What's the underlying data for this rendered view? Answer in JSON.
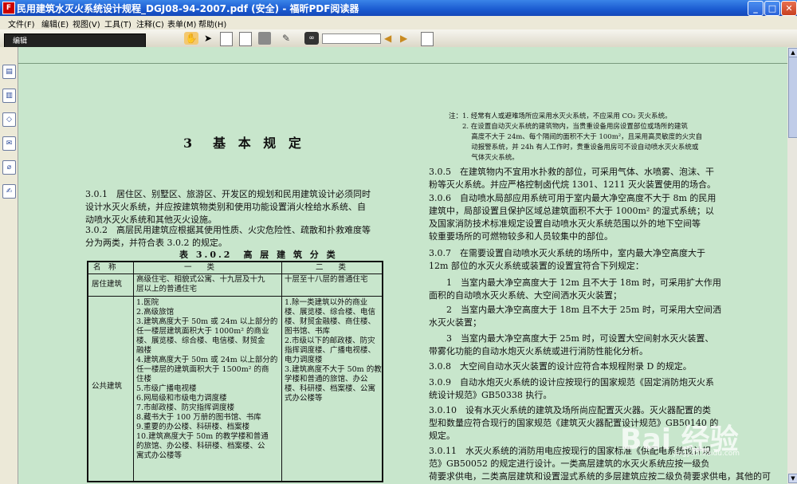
{
  "window": {
    "title": "民用建筑水灭火系统设计规程_DGJ08-94-2007.pdf (安全) - 福昕PDF阅读器",
    "minimize": "_",
    "maximize": "□",
    "close": "✕"
  },
  "menu": [
    "文件(F)",
    "编辑(E)",
    "视图(V)",
    "工具(T)",
    "注释(C)",
    "表单(M)",
    "帮助(H)"
  ],
  "edit_toolbar": {
    "label": "编辑"
  },
  "document": {
    "heading": "3　基 本 规 定",
    "left_paragraphs": [
      [
        "3.0.1　居住区、别墅区、旅游区、开发区的规划和民用建筑设计必须同时",
        "设计水灭火系统，并应按建筑物类别和使用功能设置消火栓给水系统、自",
        "动喷水灭火系统和其他灭火设施。"
      ],
      [
        "3.0.2　高层民用建筑应根据其使用性质、火灾危险性、疏散和扑救难度等",
        "分为两类，并符合表 3.0.2 的规定。"
      ]
    ],
    "table": {
      "caption": "表 3.0.2　高 层 建 筑 分 类",
      "headers": [
        "名　称",
        "一　　类",
        "二　　类"
      ],
      "row1": {
        "name": "居住建筑",
        "class1": [
          "高级住宅、相貌式公寓、十九层及十九",
          "层以上的普通住宅"
        ],
        "class2": [
          "十层至十八层的普通住宅"
        ]
      },
      "row2": {
        "name": "公共建筑",
        "class1": [
          "1.医院",
          "2.高级旅馆",
          "3.建筑高度大于 50m 或 24m 以上部分的",
          "任一楼层建筑面积大于 1000m² 的商业",
          "楼、展览楼、综合楼、电信楼、财贸金",
          "融楼",
          "4.建筑高度大于 50m 或 24m 以上部分的",
          "任一楼层的建筑面积大于 1500m² 的商",
          "住楼",
          "5.市级广播电视楼",
          "6.网局级和市级电力调度楼",
          "7.市邮政楼、防灾指挥调度楼",
          "8.藏书大于 100 万册的图书馆、书库",
          "9.重要的办公楼、科研楼、档案楼",
          "10.建筑高度大于 50m 的教学楼和普通",
          "的旅馆、办公楼、科研楼、档案楼、公",
          "寓式办公楼等"
        ],
        "class2": [
          "1.除一类建筑以外的商业",
          "楼、展览楼、综合楼、电信",
          "楼、财贸金融楼、商住楼、",
          "图书馆、书库",
          "2.市级以下的邮政楼、防灾",
          "指挥调度楼、广播电视楼、",
          "电力调度楼",
          "3.建筑高度不大于 50m 的教",
          "学楼和普通的旅馆、办公",
          "楼、科研楼、档案楼、公寓",
          "式办公楼等"
        ]
      }
    },
    "notes": [
      "注：1. 经常有人或避难场所应采用水灭火系统，不应采用 CO₂ 灭火系统。",
      "　　2. 在设置自动灭火系统的建筑物内，当贵重设备用房设置部位或场所的建筑",
      "　　　 高度不大于 24m、每个隔间的面积不大于 100m²，且采用高灵敏度的火灾自",
      "　　　 动报警系统，并 24h 有人工作时，贵重设备用房可不设自动喷水灭火系统或",
      "　　　 气体灭火系统。"
    ],
    "right_paragraphs": [
      [
        "3.0.5　在建筑物内不宜用水扑救的部位，可采用气体、水喷雾、泡沫、干",
        "粉等灭火系统。并应严格控制卤代烷 1301、1211 灭火装置使用的场合。"
      ],
      [
        "3.0.6　自动喷水局部应用系统可用于室内最大净空高度不大于 8m 的民用",
        "建筑中，局部设置且保护区域总建筑面积不大于 1000m² 的湿式系统；以",
        "及国家消防技术标准规定设置自动喷水灭火系统范围以外的地下空间等",
        "较重要场所的可燃物较多和人员较集中的部位。"
      ],
      [
        "3.0.7　在需要设置自动喷水灭火系统的场所中，室内最大净空高度大于",
        "12m 部位的水灭火系统或装置的设置宜符合下列规定："
      ],
      [
        "　　1　当室内最大净空高度大于 12m 且不大于 18m 时，可采用扩大作用",
        "面积的自动喷水灭火系统、大空间洒水灭火装置；"
      ],
      [
        "　　2　当室内最大净空高度大于 18m 且不大于 25m 时，可采用大空间洒",
        "水灭火装置；"
      ],
      [
        "　　3　当室内最大净空高度大于 25m 时，可设置大空间射水灭火装置、",
        "带雾化功能的自动水炮灭火系统或进行消防性能化分析。"
      ],
      [
        "3.0.8　大空间自动水灭火装置的设计应符合本规程附录 D 的规定。"
      ],
      [
        "3.0.9　自动水炮灭火系统的设计应按现行的国家规范《固定消防炮灭火系",
        "统设计规范》GB50338 执行。"
      ],
      [
        "3.0.10　设有水灭火系统的建筑及场所尚应配置灭火器。灭火器配置的类",
        "型和数量应符合现行的国家规范《建筑灭火器配置设计规范》GB50140 的",
        "规定。"
      ],
      [
        "3.0.11　水灭火系统的消防用电应按现行的国家标准《供配电系统设计规",
        "范》GB50052 的规定进行设计。一类高层建筑的水灭火系统应按一级负",
        "荷要求供电，二类高层建筑和设置湿式系统的多层建筑应按二级负荷要求供电，其他的可"
      ]
    ]
  },
  "watermark": {
    "text": "Bai 经验",
    "sub": "jingyan.baidu.com"
  },
  "colors": {
    "page_bg": "#c8e6cc",
    "titlebar": "#1a5ad0",
    "menubar": "#ece9d8"
  }
}
